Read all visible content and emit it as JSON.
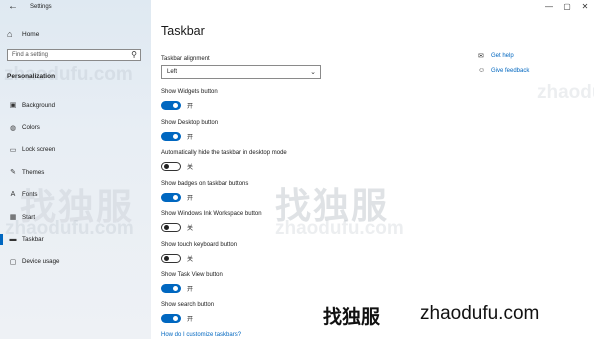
{
  "window": {
    "title": "Settings",
    "back_icon": "back-arrow-icon",
    "controls": [
      "—",
      "▢",
      "✕"
    ]
  },
  "sidebar": {
    "home_label": "Home",
    "search_placeholder": "Find a setting",
    "section_title": "Personalization",
    "items": [
      {
        "label": "Background",
        "icon": "image-icon",
        "glyph": "▣"
      },
      {
        "label": "Colors",
        "icon": "palette-icon",
        "glyph": "◍"
      },
      {
        "label": "Lock screen",
        "icon": "lock-screen-icon",
        "glyph": "▭"
      },
      {
        "label": "Themes",
        "icon": "brush-icon",
        "glyph": "✎"
      },
      {
        "label": "Fonts",
        "icon": "font-icon",
        "glyph": "A"
      },
      {
        "label": "Start",
        "icon": "start-icon",
        "glyph": "▦"
      },
      {
        "label": "Taskbar",
        "icon": "taskbar-icon",
        "glyph": "▬",
        "active": true
      },
      {
        "label": "Device usage",
        "icon": "device-icon",
        "glyph": "▢"
      }
    ]
  },
  "main": {
    "title": "Taskbar",
    "alignment": {
      "label": "Taskbar alignment",
      "value": "Left"
    },
    "toggles": [
      {
        "label": "Show Widgets button",
        "on": true,
        "state": "开"
      },
      {
        "label": "Show Desktop button",
        "on": true,
        "state": "开"
      },
      {
        "label": "Automatically hide the taskbar in desktop mode",
        "on": false,
        "state": "关"
      },
      {
        "label": "Show badges on taskbar buttons",
        "on": true,
        "state": "开"
      },
      {
        "label": "Show Windows Ink Workspace button",
        "on": false,
        "state": "关"
      },
      {
        "label": "Show touch keyboard button",
        "on": false,
        "state": "关"
      },
      {
        "label": "Show Task View button",
        "on": true,
        "state": "开"
      },
      {
        "label": "Show search button",
        "on": true,
        "state": "开"
      }
    ],
    "customize_link": "How do I customize taskbars?",
    "help": [
      {
        "label": "Get help",
        "icon": "help-chat-icon",
        "glyph": "✉"
      },
      {
        "label": "Give feedback",
        "icon": "feedback-icon",
        "glyph": "☺"
      }
    ]
  },
  "watermarks": {
    "cn": "找独服",
    "url": "zhaodufu.com",
    "url_short": "zhaodufu"
  },
  "colors": {
    "accent": "#0067c0",
    "sidebar_bg": "#e4ecf3"
  }
}
